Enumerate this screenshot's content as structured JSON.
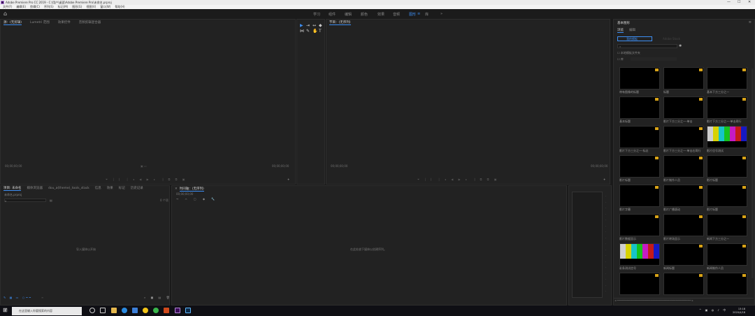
{
  "window": {
    "title": "Adobe Premiere Pro CC 2019 - C:\\用户\\桌面\\Adobe Premiere Pro\\未命名.prproj",
    "controls": [
      "—",
      "☐",
      "✕"
    ]
  },
  "menu": [
    "文件(F)",
    "编辑(E)",
    "剪辑(C)",
    "序列(S)",
    "标记(M)",
    "图形(G)",
    "视图(V)",
    "窗口(W)",
    "帮助(H)"
  ],
  "workspaces": {
    "items": [
      "学习",
      "组件",
      "编辑",
      "颜色",
      "效果",
      "音频",
      "图形",
      "库"
    ],
    "active_index": 6,
    "more": "»"
  },
  "source_panel": {
    "tabs": [
      "源：(无剪辑)",
      "Lumetri 范围",
      "效果控件",
      "音频剪辑混合器"
    ],
    "timecode_left": "00;00;00;00",
    "timecode_right": "00;00;00;00"
  },
  "program_panel": {
    "tab": "节目：(无序列)",
    "timecode_left": "00;00;00;00",
    "timecode_right": "00;00;00;00"
  },
  "tools": [
    "▶",
    "⇥",
    "↔",
    "◆",
    "⋈",
    "✎",
    "✋",
    "T"
  ],
  "project_panel": {
    "tabs": [
      "项目: 未命名",
      "媒体浏览器",
      "dou_a(theme)_tools_stack",
      "信息",
      "效果",
      "标记",
      "历史记录"
    ],
    "file": "未命名.prproj",
    "items_count": "0 个项",
    "empty_text": "导入媒体以开始"
  },
  "timeline_panel": {
    "tab": "时间轴：(无序列)",
    "timecode": "00;00;00;00",
    "empty_text": "在此处放下媒体以创建序列。"
  },
  "essential_graphics": {
    "title": "基本图形",
    "tabs": [
      "浏览",
      "编辑"
    ],
    "library_buttons": [
      "我的模板",
      "Adobe Stock"
    ],
    "search_placeholder": "",
    "checkbox_local": "本地模板文件夹",
    "checkbox_all": "库",
    "templates": [
      "带有图像的标题",
      "标题",
      "基本下方三分之一",
      "基本标题",
      "影片下方三分之一-单击",
      "影片下方三分之一-单击两行",
      "影片下方三分之一-标志",
      "影片下方三分之一-单击右两行",
      "影片信号测试",
      "影片标题",
      "影片制作人员",
      "影片标题",
      "影片字幕",
      "影片广播滚动",
      "影片标题",
      "影片数据显示",
      "影片转场显示",
      "新闻下方三分之一",
      "彩条测试信号",
      "新闻标题",
      "新闻制作人员",
      "",
      "",
      ""
    ]
  },
  "taskbar": {
    "search_placeholder": "在这里输入你要搜索的内容",
    "time": "13:18",
    "date": "2020/4/18"
  },
  "colors": {
    "accent": "#3d8ef3",
    "panel_bg": "#222222",
    "badge": "#d8a318"
  }
}
